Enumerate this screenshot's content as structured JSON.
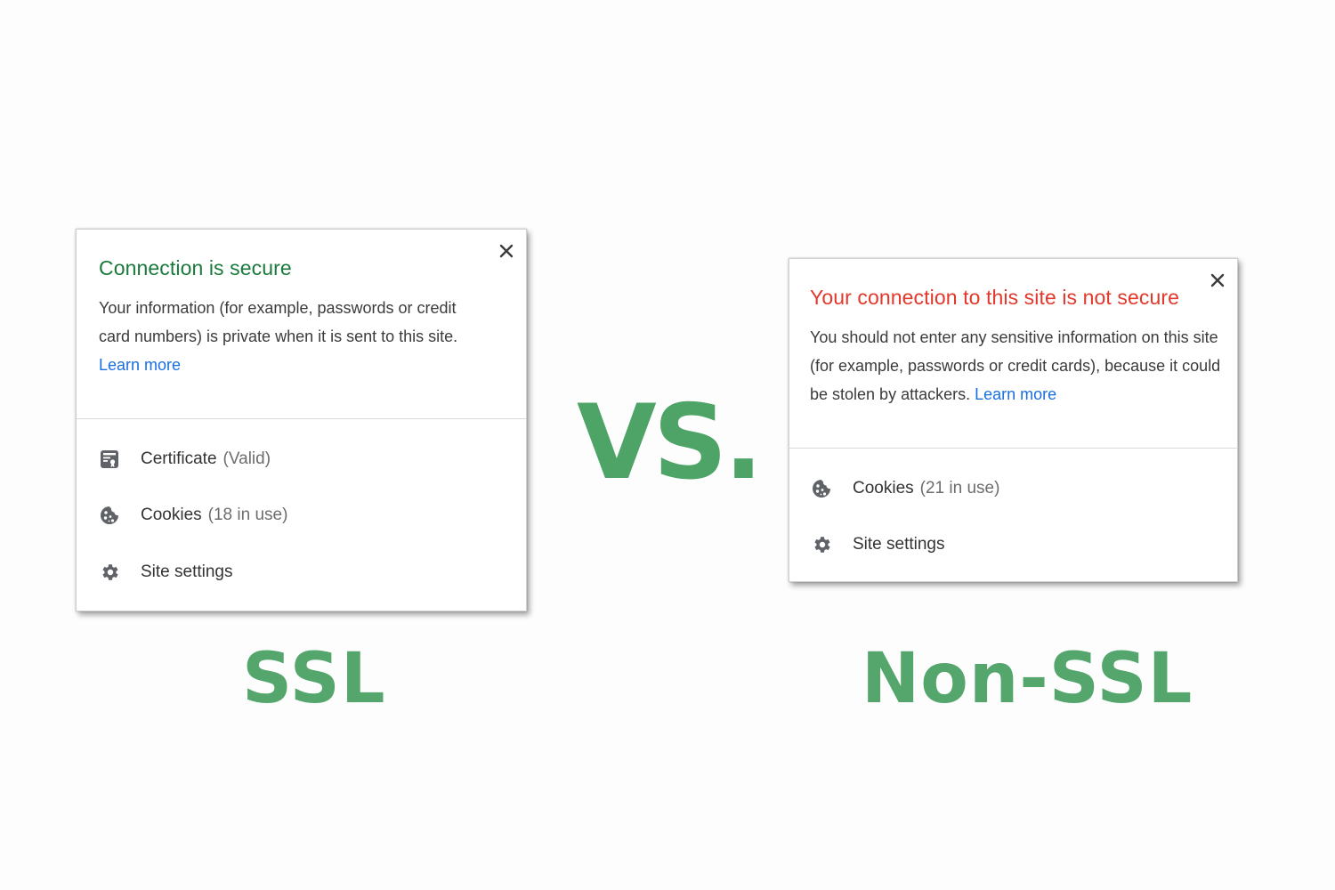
{
  "ssl_popup": {
    "title": "Connection is secure",
    "description": "Your information (for example, passwords or credit card numbers) is private when it is sent to this site.",
    "learn_more": "Learn more",
    "rows": [
      {
        "label": "Certificate",
        "sub": "(Valid)",
        "icon": "certificate-icon"
      },
      {
        "label": "Cookies",
        "sub": "(18 in use)",
        "icon": "cookie-icon"
      },
      {
        "label": "Site settings",
        "sub": "",
        "icon": "gear-icon"
      }
    ]
  },
  "nonssl_popup": {
    "title": "Your connection to this site is not secure",
    "description": "You should not enter any sensitive information on this site (for example, passwords or credit cards), because it could be stolen by attackers.",
    "learn_more": "Learn more",
    "rows": [
      {
        "label": "Cookies",
        "sub": "(21 in use)",
        "icon": "cookie-icon"
      },
      {
        "label": "Site settings",
        "sub": "",
        "icon": "gear-icon"
      }
    ]
  },
  "vs_text": "VS.",
  "captions": {
    "ssl": "SSL",
    "nonssl": "Non-SSL"
  },
  "colors": {
    "secure_title": "#1a7a3b",
    "insecure_title": "#e2372b",
    "link": "#1a6fe0",
    "accent_green": "#4ea467"
  }
}
